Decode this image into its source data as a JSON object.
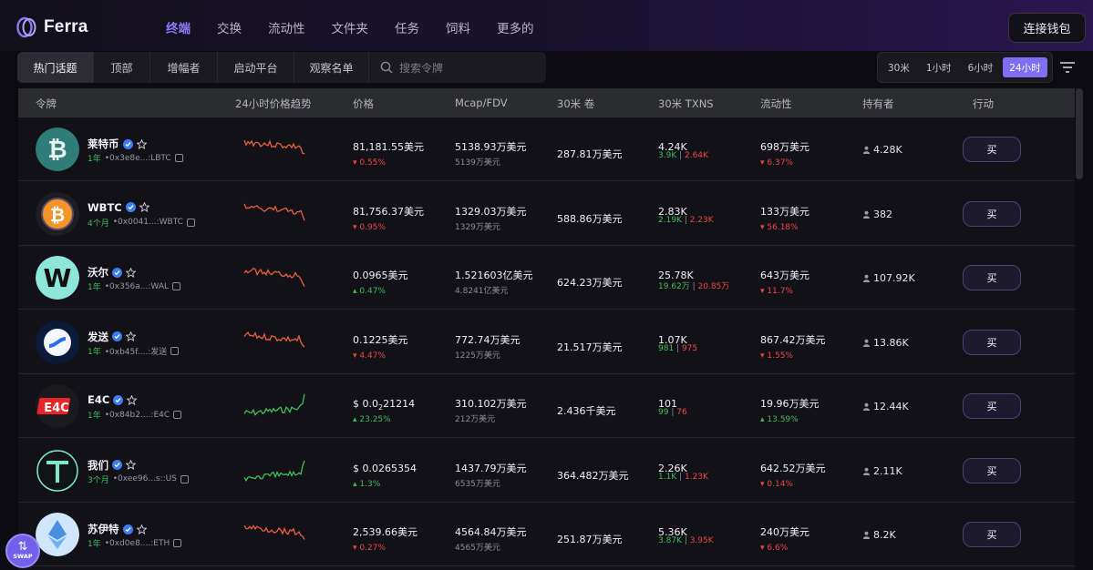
{
  "brand": {
    "name": "Ferra",
    "accent": "#8b7cf6"
  },
  "nav": {
    "items": [
      {
        "label": "终端",
        "active": true
      },
      {
        "label": "交换",
        "active": false
      },
      {
        "label": "流动性",
        "active": false
      },
      {
        "label": "文件夹",
        "active": false
      },
      {
        "label": "任务",
        "active": false
      },
      {
        "label": "饲料",
        "active": false
      },
      {
        "label": "更多的",
        "active": false
      }
    ]
  },
  "connect_wallet_label": "连接钱包",
  "filters": {
    "tabs": [
      {
        "label": "热门话题",
        "active": true
      },
      {
        "label": "顶部",
        "active": false
      },
      {
        "label": "增幅者",
        "active": false
      },
      {
        "label": "启动平台",
        "active": false
      },
      {
        "label": "观察名单",
        "active": false
      }
    ],
    "search_placeholder": "搜索令牌"
  },
  "timeframes": [
    {
      "label": "30米",
      "active": false
    },
    {
      "label": "1小时",
      "active": false
    },
    {
      "label": "6小时",
      "active": false
    },
    {
      "label": "24小时",
      "active": true
    }
  ],
  "table": {
    "headers": [
      "令牌",
      "24小时价格趋势",
      "价格",
      "Mcap/FDV",
      "30米 卷",
      "30米 TXNS",
      "流动性",
      "持有者",
      "行动"
    ],
    "rows": [
      {
        "name": "莱特币",
        "age": "1年",
        "addr": "0x3e8e...:LBTC",
        "trend": "down",
        "price": "81,181.55美元",
        "price_chg": "0.55%",
        "price_dir": "down",
        "mcap": "5138.93万美元",
        "fdv": "5139万美元",
        "vol": "287.81万美元",
        "txns": "4.24K",
        "buys": "3.9K",
        "sells": "2.64K",
        "liq": "698万美元",
        "liq_chg": "6.37%",
        "liq_dir": "down",
        "holders": "4.28K",
        "buy_label": "买",
        "icon": "bitcoin-icon"
      },
      {
        "name": "WBTC",
        "age": "4个月",
        "addr": "0x0041...:WBTC",
        "trend": "down",
        "price": "81,756.37美元",
        "price_chg": "0.95%",
        "price_dir": "down",
        "mcap": "1329.03万美元",
        "fdv": "1329万美元",
        "vol": "588.86万美元",
        "txns": "2.83K",
        "buys": "2.19K",
        "sells": "2.23K",
        "liq": "133万美元",
        "liq_chg": "56.18%",
        "liq_dir": "down",
        "holders": "382",
        "buy_label": "买",
        "icon": "wbtc-icon"
      },
      {
        "name": "沃尔",
        "age": "1年",
        "addr": "0x356a...:WAL",
        "trend": "down",
        "price": "0.0965美元",
        "price_chg": "0.47%",
        "price_dir": "up",
        "mcap": "1.521603亿美元",
        "fdv": "4.8241亿美元",
        "vol": "624.23万美元",
        "txns": "25.78K",
        "buys": "19.62万",
        "sells": "20.85万",
        "liq": "643万美元",
        "liq_chg": "11.7%",
        "liq_dir": "down",
        "holders": "107.92K",
        "buy_label": "买",
        "icon": "walrus-icon"
      },
      {
        "name": "发送",
        "age": "1年",
        "addr": "0xb45f....:发送",
        "trend": "down",
        "price": "0.1225美元",
        "price_chg": "4.47%",
        "price_dir": "down",
        "mcap": "772.74万美元",
        "fdv": "1225万美元",
        "vol": "21.517万美元",
        "txns": "1.07K",
        "buys": "981",
        "sells": "975",
        "liq": "867.42万美元",
        "liq_chg": "1.55%",
        "liq_dir": "down",
        "holders": "13.86K",
        "buy_label": "买",
        "icon": "send-icon"
      },
      {
        "name": "E4C",
        "age": "1年",
        "addr": "0x84b2....:E4C",
        "trend": "up",
        "price_prefix": "$ 0.0",
        "price_sub": "2",
        "price_suffix": "21214",
        "price_chg": "23.25%",
        "price_dir": "up",
        "mcap": "310.102万美元",
        "fdv": "212万美元",
        "vol": "2.436千美元",
        "txns": "101",
        "buys": "99",
        "sells": "76",
        "liq": "19.96万美元",
        "liq_chg": "13.59%",
        "liq_dir": "up",
        "holders": "12.44K",
        "buy_label": "买",
        "icon": "e4c-icon"
      },
      {
        "name": "我们",
        "age": "3个月",
        "addr": "0xee96...s::US",
        "trend": "up",
        "price": "$ 0.0265354",
        "price_chg": "1.3%",
        "price_dir": "up",
        "mcap": "1437.79万美元",
        "fdv": "6535万美元",
        "vol": "364.482万美元",
        "txns": "2.26K",
        "buys": "1.1K",
        "sells": "1.23K",
        "liq": "642.52万美元",
        "liq_chg": "0.14%",
        "liq_dir": "down",
        "holders": "2.11K",
        "buy_label": "买",
        "icon": "us-t-icon"
      },
      {
        "name": "苏伊特",
        "age": "1年",
        "addr": "0xd0e8....:ETH",
        "trend": "down",
        "price": "2,539.66美元",
        "price_chg": "0.27%",
        "price_dir": "down",
        "mcap": "4564.84万美元",
        "fdv": "4565万美元",
        "vol": "251.87万美元",
        "txns": "5.36K",
        "buys": "3.87K",
        "sells": "3.95K",
        "liq": "240万美元",
        "liq_chg": "6.6%",
        "liq_dir": "down",
        "holders": "8.2K",
        "buy_label": "买",
        "icon": "ethereum-icon"
      }
    ]
  },
  "swap_fab": {
    "label": "SWAP"
  },
  "colors": {
    "up": "#3fbf5a",
    "down": "#ef4747",
    "spark_down": "#e8603c",
    "spark_up": "#3fbf5a"
  }
}
